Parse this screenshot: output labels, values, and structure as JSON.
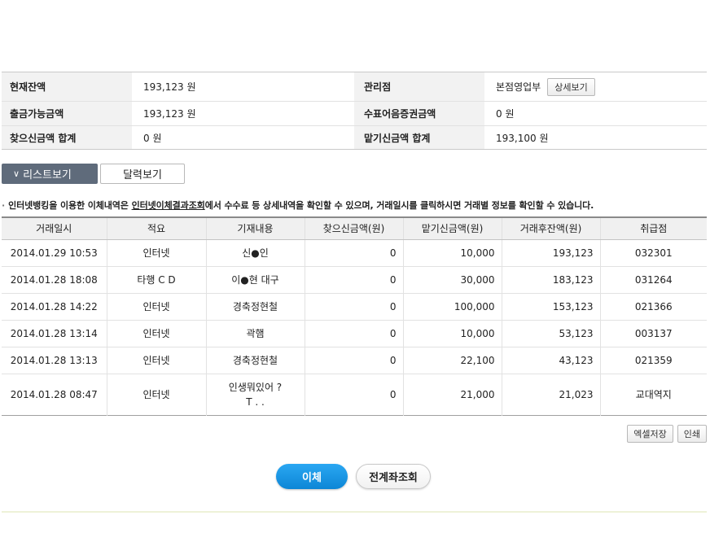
{
  "summary": {
    "balance_label": "현재잔액",
    "balance_value": "193,123 원",
    "branch_label": "관리점",
    "branch_value": "본점영업부",
    "detail_button": "상세보기",
    "withdrawable_label": "출금가능금액",
    "withdrawable_value": "193,123 원",
    "check_label": "수표어음증권금액",
    "check_value": "0 원",
    "withdraw_total_label": "찾으신금액 합계",
    "withdraw_total_value": "0 원",
    "deposit_total_label": "맡기신금액 합계",
    "deposit_total_value": "193,100 원"
  },
  "tabs": {
    "list_view": "리스트보기",
    "calendar_view": "달력보기"
  },
  "notice": {
    "bullet": "·",
    "before": "인터넷뱅킹을 이용한 이체내역은 ",
    "link": "인터넷이체결과조회",
    "after": "에서 수수료 등 상세내역을 확인할 수 있으며, 거래일시를 클릭하시면 거래별 정보를 확인할 수 있습니다."
  },
  "table": {
    "headers": [
      "거래일시",
      "적요",
      "기재내용",
      "찾으신금액(원)",
      "맡기신금액(원)",
      "거래후잔액(원)",
      "취급점"
    ],
    "rows": [
      {
        "datetime": "2014.01.29 10:53",
        "type": "인터넷",
        "memo": "신●인",
        "withdraw": "0",
        "deposit": "10,000",
        "balance": "193,123",
        "branch": "032301"
      },
      {
        "datetime": "2014.01.28 18:08",
        "type": "타행 C D",
        "memo": "이●현 대구",
        "withdraw": "0",
        "deposit": "30,000",
        "balance": "183,123",
        "branch": "031264"
      },
      {
        "datetime": "2014.01.28 14:22",
        "type": "인터넷",
        "memo": "경축정현철",
        "withdraw": "0",
        "deposit": "100,000",
        "balance": "153,123",
        "branch": "021366"
      },
      {
        "datetime": "2014.01.28 13:14",
        "type": "인터넷",
        "memo": "곽햄",
        "withdraw": "0",
        "deposit": "10,000",
        "balance": "53,123",
        "branch": "003137"
      },
      {
        "datetime": "2014.01.28 13:13",
        "type": "인터넷",
        "memo": "경축정현철",
        "withdraw": "0",
        "deposit": "22,100",
        "balance": "43,123",
        "branch": "021359"
      },
      {
        "datetime": "2014.01.28 08:47",
        "type": "인터넷",
        "memo_line1": "인생뭐있어 ?",
        "memo_line2": "T . .",
        "withdraw": "0",
        "deposit": "21,000",
        "balance": "21,023",
        "branch": "교대역지"
      }
    ]
  },
  "buttons": {
    "excel": "엑셀저장",
    "print": "인쇄",
    "transfer": "이체",
    "all_accounts": "전계좌조회"
  },
  "colors": {
    "tab_active_bg": "#5f6b7b",
    "primary_button": "#1796e4",
    "label_bg": "#f2f2f2"
  }
}
